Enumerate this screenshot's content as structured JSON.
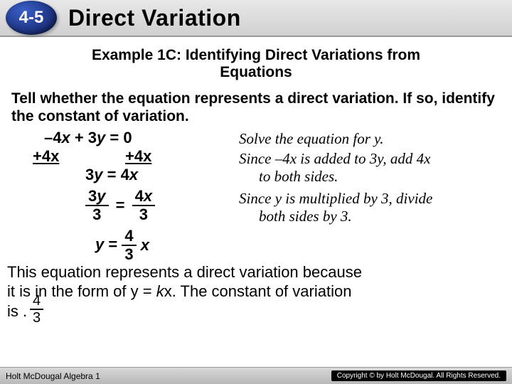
{
  "header": {
    "section_number": "4-5",
    "title": "Direct Variation"
  },
  "example_title_line1": "Example 1C: Identifying Direct Variations from",
  "example_title_line2": "Equations",
  "instruction": "Tell whether the equation represents a direct variation. If so, identify the constant of variation.",
  "equations": {
    "eq1": "–4x + 3y = 0",
    "add_left": "+4x",
    "add_right": "+4x",
    "eq2": "3y = 4x",
    "frac_left_num": "3y",
    "frac_left_den": "3",
    "equals": "=",
    "frac_right_num": "4x",
    "frac_right_den": "3",
    "final_left": "y =",
    "final_frac_num": "4",
    "final_frac_den": "3",
    "final_right": "x"
  },
  "notes": {
    "n1": "Solve the equation for y.",
    "n2_a": "Since –4x is added to 3y, add 4x",
    "n2_b": "to both sides.",
    "n3_a": "Since y is multiplied by 3, divide",
    "n3_b": "both sides by 3."
  },
  "conclusion_a": "This equation represents a direct variation because",
  "conclusion_b_pre": "it is in the form of y = ",
  "conclusion_b_k": "k",
  "conclusion_b_post": "x. The constant of variation",
  "conclusion_c": "is    .",
  "conclusion_frac_num": "4",
  "conclusion_frac_den": "3",
  "footer": {
    "book": "Holt McDougal Algebra 1",
    "copyright": "Copyright © by Holt McDougal. All Rights Reserved."
  }
}
